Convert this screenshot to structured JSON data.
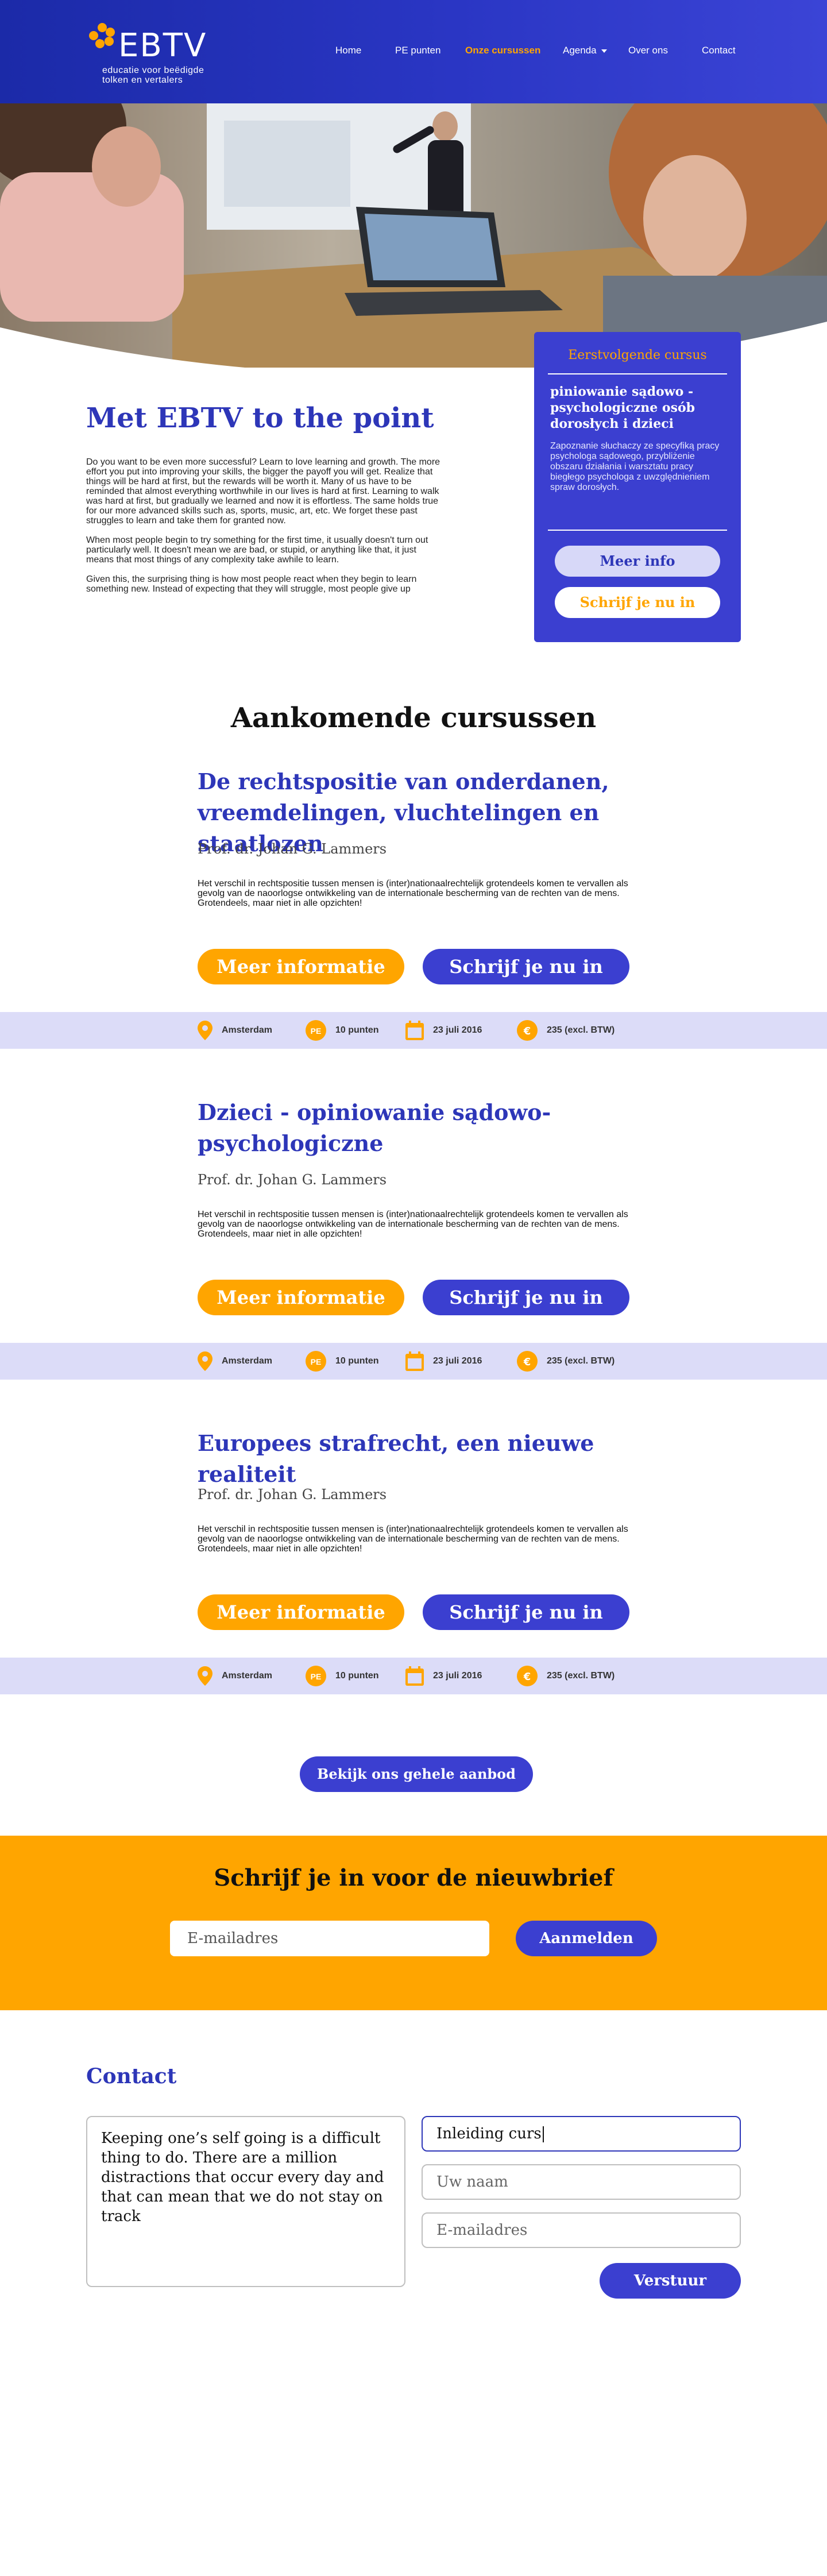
{
  "header": {
    "logo_text": "EBTV",
    "logo_sub_1": "educatie voor beëdigde",
    "logo_sub_2": "tolken en vertalers",
    "nav": [
      "Home",
      "PE punten",
      "Onze cursussen",
      "Agenda",
      "Over ons",
      "Contact"
    ],
    "active_nav": "Onze cursussen",
    "accent": "#ffa500",
    "brand": "#2d36b8"
  },
  "intro": {
    "title": "Met EBTV to the point",
    "paragraphs": [
      "Do you want to be even more successful? Learn to love learning and growth. The more effort you put into improving your skills, the bigger the payoff you will get. Realize that things will be hard at first, but the rewards will be worth it. Many of us have to be reminded that almost everything worthwhile in our lives is hard at first. Learning to walk was hard at first, but gradually we learned and now it is effortless. The same holds true for our more advanced skills such as, sports, music, art, etc. We forget these past struggles to learn and take them for granted now.",
      "When most people begin to try something for the first time, it usually doesn't turn out particularly well. It doesn't mean we are bad, or stupid, or anything like that, it just means that most things of any complexity take awhile to learn.",
      "Given this, the surprising thing is how most people react when they begin to learn something new. Instead of expecting that they will struggle, most people give up"
    ]
  },
  "next_course": {
    "label": "Eerstvolgende cursus",
    "title": "piniowanie sądowo - psychologiczne osób dorosłych i dzieci",
    "description": "Zapoznanie słuchaczy ze specyfiką pracy psychologa sądowego, przybliżenie obszaru działania i warsztatu pracy biegłego psychologa z uwzględnieniem spraw dorosłych.",
    "info_label": "Meer info",
    "join_label": "Schrijf je nu in"
  },
  "courses_section": {
    "title": "Aankomende cursussen",
    "courses": [
      {
        "title": "De rechtspositie van onderdanen, vreemdelingen, vluchtelingen en staatlozen",
        "teacher": "Prof. dr. Johan G. Lammers",
        "description": "Het verschil in rechtspositie tussen mensen is (inter)nationaalrechtelijk grotendeels komen te vervallen als gevolg van de naoorlogse ontwikkeling van de internationale bescherming van de rechten van de mens. Grotendeels, maar niet in alle opzichten!",
        "info_label": "Meer informatie",
        "join_label": "Schrijf je nu in",
        "location": "Amsterdam",
        "pe_badge": "PE",
        "points": "10 punten",
        "date": "23 juli 2016",
        "price_symbol": "€",
        "price": "235 (excl. BTW)"
      },
      {
        "title": "Dzieci - opiniowanie sądowo-psychologiczne",
        "teacher": "Prof. dr. Johan G. Lammers",
        "description": "Het verschil in rechtspositie tussen mensen is (inter)nationaalrechtelijk grotendeels komen te vervallen als gevolg van de naoorlogse ontwikkeling van de internationale bescherming van de rechten van de mens. Grotendeels, maar niet in alle opzichten!",
        "info_label": "Meer informatie",
        "join_label": "Schrijf je nu in",
        "location": "Amsterdam",
        "pe_badge": "PE",
        "points": "10 punten",
        "date": "23 juli 2016",
        "price_symbol": "€",
        "price": "235 (excl. BTW)"
      },
      {
        "title": "Europees strafrecht, een nieuwe realiteit",
        "teacher": "Prof. dr. Johan G. Lammers",
        "description": "Het verschil in rechtspositie tussen mensen is (inter)nationaalrechtelijk grotendeels komen te vervallen als gevolg van de naoorlogse ontwikkeling van de internationale bescherming van de rechten van de mens. Grotendeels, maar niet in alle opzichten!",
        "info_label": "Meer informatie",
        "join_label": "Schrijf je nu in",
        "location": "Amsterdam",
        "pe_badge": "PE",
        "points": "10 punten",
        "date": "23 juli 2016",
        "price_symbol": "€",
        "price": "235 (excl. BTW)"
      }
    ],
    "all_label": "Bekijk ons gehele aanbod"
  },
  "newsletter": {
    "title": "Schrijf je in voor de nieuwbrief",
    "email_placeholder": "E-mailadres",
    "submit_label": "Aanmelden"
  },
  "contact": {
    "title": "Contact",
    "message": "Keeping one’s self going is a difficult thing to do. There are a million distractions that occur every day and that can mean that we do not stay on track",
    "subject_value": "Inleiding curs",
    "name_placeholder": "Uw naam",
    "email_placeholder": "E-mailadres",
    "submit_label": "Verstuur"
  }
}
